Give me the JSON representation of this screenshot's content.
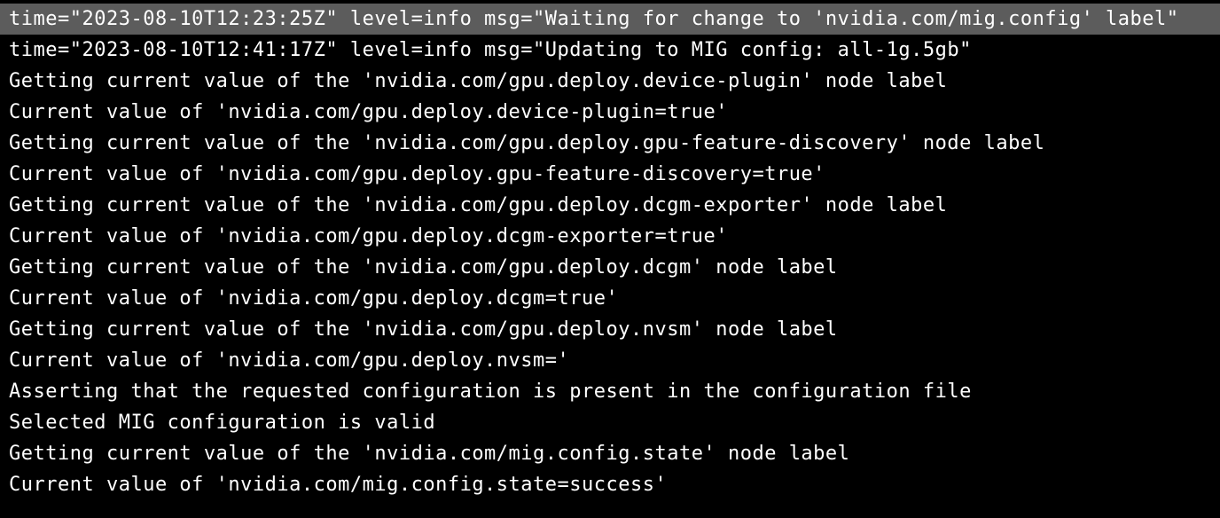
{
  "log": {
    "lines": [
      "time=\"2023-08-10T12:23:25Z\" level=info msg=\"Waiting for change to 'nvidia.com/mig.config' label\"",
      "time=\"2023-08-10T12:41:17Z\" level=info msg=\"Updating to MIG config: all-1g.5gb\"",
      "Getting current value of the 'nvidia.com/gpu.deploy.device-plugin' node label",
      "Current value of 'nvidia.com/gpu.deploy.device-plugin=true'",
      "Getting current value of the 'nvidia.com/gpu.deploy.gpu-feature-discovery' node label",
      "Current value of 'nvidia.com/gpu.deploy.gpu-feature-discovery=true'",
      "Getting current value of the 'nvidia.com/gpu.deploy.dcgm-exporter' node label",
      "Current value of 'nvidia.com/gpu.deploy.dcgm-exporter=true'",
      "Getting current value of the 'nvidia.com/gpu.deploy.dcgm' node label",
      "Current value of 'nvidia.com/gpu.deploy.dcgm=true'",
      "Getting current value of the 'nvidia.com/gpu.deploy.nvsm' node label",
      "Current value of 'nvidia.com/gpu.deploy.nvsm='",
      "Asserting that the requested configuration is present in the configuration file",
      "Selected MIG configuration is valid",
      "Getting current value of the 'nvidia.com/mig.config.state' node label",
      "Current value of 'nvidia.com/mig.config.state=success'"
    ],
    "highlighted_index": 0
  }
}
